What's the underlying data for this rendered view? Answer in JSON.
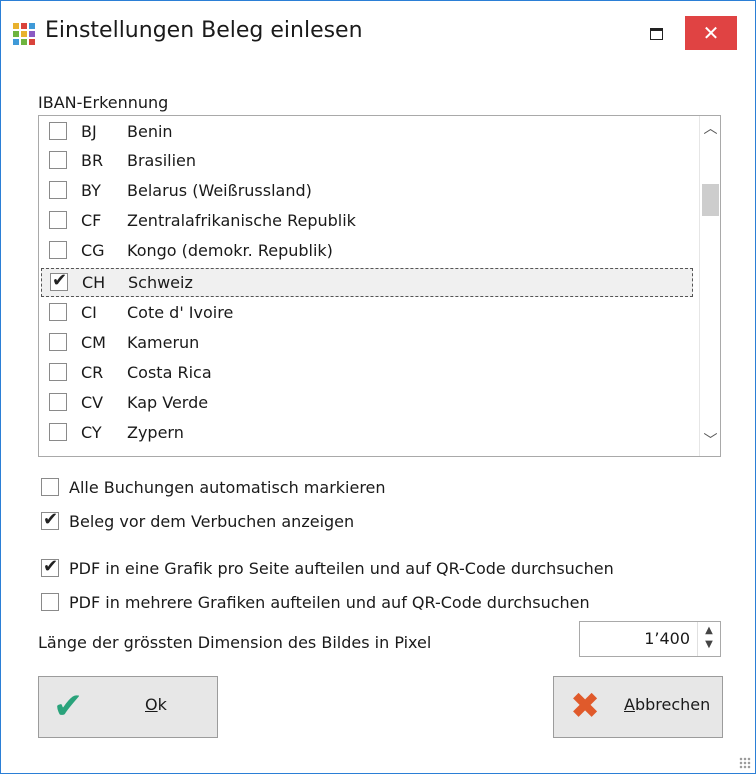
{
  "window": {
    "title": "Einstellungen Beleg einlesen",
    "close_symbol": "✕"
  },
  "iban": {
    "label": "IBAN-Erkennung",
    "items": [
      {
        "code": "BJ",
        "name": "Benin",
        "checked": false
      },
      {
        "code": "BR",
        "name": "Brasilien",
        "checked": false
      },
      {
        "code": "BY",
        "name": "Belarus (Weißrussland)",
        "checked": false
      },
      {
        "code": "CF",
        "name": "Zentralafrikanische Republik",
        "checked": false
      },
      {
        "code": "CG",
        "name": "Kongo (demokr. Republik)",
        "checked": false
      },
      {
        "code": "CH",
        "name": "Schweiz",
        "checked": true
      },
      {
        "code": "CI",
        "name": "Cote d' Ivoire",
        "checked": false
      },
      {
        "code": "CM",
        "name": "Kamerun",
        "checked": false
      },
      {
        "code": "CR",
        "name": "Costa Rica",
        "checked": false
      },
      {
        "code": "CV",
        "name": "Kap Verde",
        "checked": false
      },
      {
        "code": "CY",
        "name": "Zypern",
        "checked": false
      }
    ]
  },
  "options": [
    {
      "label": "Alle Buchungen automatisch markieren",
      "checked": false
    },
    {
      "label": "Beleg vor dem Verbuchen anzeigen",
      "checked": true
    },
    {
      "label": "PDF in eine Grafik pro Seite aufteilen und auf QR-Code durchsuchen",
      "checked": true
    },
    {
      "label": "PDF in mehrere Grafiken aufteilen und auf QR-Code durchsuchen",
      "checked": false
    }
  ],
  "dimension": {
    "label": "Länge der grössten Dimension des Bildes in Pixel",
    "value": "1’400"
  },
  "buttons": {
    "ok_first": "O",
    "ok_rest": "k",
    "cancel_first": "A",
    "cancel_rest": "bbrechen"
  },
  "icons": {
    "app": "app-grid-icon",
    "ok": "checkmark-icon",
    "cancel": "x-mark-icon"
  },
  "colors": {
    "close_button": "#e04343",
    "ok_icon": "#2aa37b",
    "cancel_icon": "#e05a2b",
    "window_border": "#2b7fd6"
  }
}
